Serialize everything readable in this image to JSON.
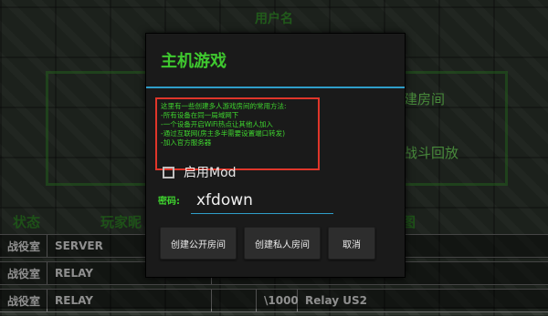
{
  "background": {
    "title": "用户名",
    "right_button_1": "建房间",
    "right_button_2": "战斗回放",
    "status_labels": [
      "状态",
      "玩家昵",
      "图"
    ],
    "rows": [
      {
        "type": "战役室",
        "server": "SERVER",
        "col3": "",
        "col4": ""
      },
      {
        "type": "战役室",
        "server": "RELAY",
        "col3": "",
        "col4": ""
      },
      {
        "type": "战役室",
        "server": "RELAY",
        "col3": "\\1000",
        "col4": "Relay US2"
      }
    ]
  },
  "dialog": {
    "title": "主机游戏",
    "info_text": "这里有一些创建多人游戏房间的常用方法:\n-所有设备在同一局域网下\n-一个设备开启WiFi热点让其他人加入\n-通过互联网(房主多半需要设置端口转发)\n-加入官方服务器",
    "mod_checkbox_label": "启用Mod",
    "mod_checked": false,
    "password_label": "密码:",
    "password_value": "xfdown",
    "buttons": {
      "public": "创建公开房间",
      "private": "创建私人房间",
      "cancel": "取消"
    }
  },
  "colors": {
    "accent_green": "#3fc92f",
    "divider_blue": "#2f9ec9",
    "info_border_red": "#e0362a"
  }
}
